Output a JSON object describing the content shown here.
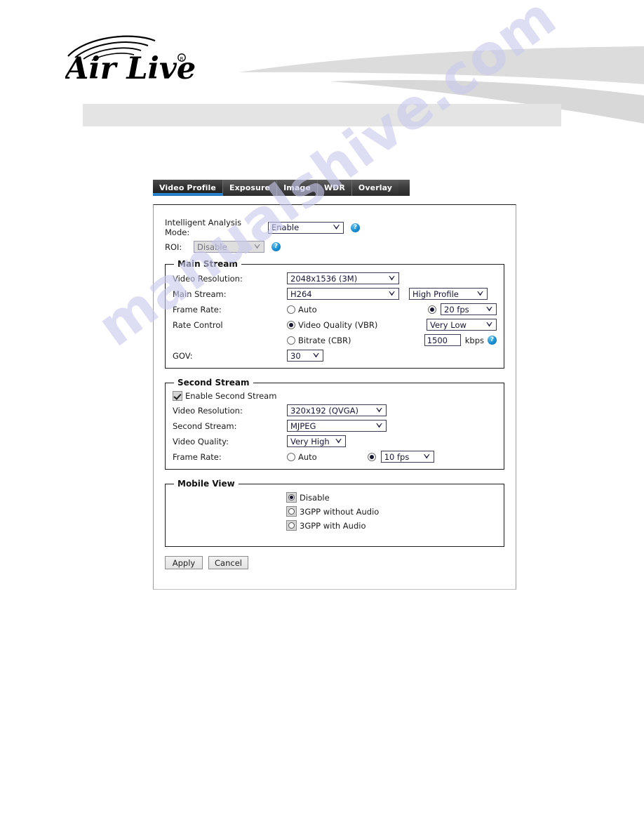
{
  "header": {
    "brand_name": "Air Live",
    "brand_trademark": "®"
  },
  "watermark": {
    "text": "manualshive.com"
  },
  "tabs": [
    {
      "label": "Video Profile",
      "active": true
    },
    {
      "label": "Exposure",
      "active": false
    },
    {
      "label": "Image",
      "active": false
    },
    {
      "label": "WDR",
      "active": false
    },
    {
      "label": "Overlay",
      "active": false
    }
  ],
  "top_settings": {
    "intelligent_analysis_mode": {
      "label": "Intelligent Analysis Mode:",
      "value": "Enable",
      "help": "?"
    },
    "roi": {
      "label": "ROI:",
      "value": "Disable",
      "disabled": true,
      "help": "?"
    }
  },
  "main_stream": {
    "legend": "Main Stream",
    "video_resolution": {
      "label": "Video Resolution:",
      "value": "2048x1536 (3M)"
    },
    "codec": {
      "label": "Main Stream:",
      "value": "H264",
      "profile_value": "High Profile"
    },
    "frame_rate": {
      "label": "Frame Rate:",
      "auto_label": "Auto",
      "auto_selected": false,
      "fixed_selected": true,
      "fps_value": "20 fps"
    },
    "rate_control": {
      "label": "Rate Control",
      "vbr_label": "Video Quality (VBR)",
      "vbr_selected": true,
      "vbr_quality": "Very Low",
      "cbr_label": "Bitrate (CBR)",
      "cbr_selected": false,
      "cbr_value": "1500",
      "cbr_unit": "kbps",
      "help": "?"
    },
    "gov": {
      "label": "GOV:",
      "value": "30"
    }
  },
  "second_stream": {
    "legend": "Second Stream",
    "enable": {
      "label": "Enable Second Stream",
      "checked": true
    },
    "video_resolution": {
      "label": "Video Resolution:",
      "value": "320x192 (QVGA)"
    },
    "codec": {
      "label": "Second Stream:",
      "value": "MJPEG"
    },
    "video_quality": {
      "label": "Video Quality:",
      "value": "Very High"
    },
    "frame_rate": {
      "label": "Frame Rate:",
      "auto_label": "Auto",
      "auto_selected": false,
      "fixed_selected": true,
      "fps_value": "10 fps"
    }
  },
  "mobile_view": {
    "legend": "Mobile View",
    "options": [
      {
        "label": "Disable",
        "selected": true
      },
      {
        "label": "3GPP without Audio",
        "selected": false
      },
      {
        "label": "3GPP with Audio",
        "selected": false
      }
    ]
  },
  "buttons": {
    "apply": "Apply",
    "cancel": "Cancel"
  },
  "colors": {
    "tab_active_underline": "#1b6fba",
    "help_icon": "#1a8fd4",
    "watermark": "#c9c9ee",
    "header_band": "#e4e4e4"
  }
}
